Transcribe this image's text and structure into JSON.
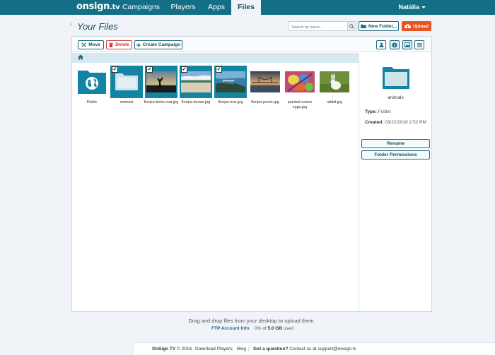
{
  "nav": {
    "logo": "onsign",
    "logo_tv": "tv",
    "items": [
      {
        "label": "Campaigns"
      },
      {
        "label": "Players"
      },
      {
        "label": "Apps"
      },
      {
        "label": "Files"
      }
    ],
    "active": "Files",
    "user": "Natália"
  },
  "header": {
    "title": "Your Files",
    "search_placeholder": "Search by name...",
    "new_folder_label": "New Folder...",
    "upload_label": "Upload"
  },
  "toolbar": {
    "move_label": "Move",
    "delete_label": "Delete",
    "create_campaign_label": "Create Campaign"
  },
  "files": [
    {
      "name": "Public",
      "kind": "folder-globe",
      "selected": false
    },
    {
      "name": "animals",
      "kind": "folder",
      "selected": true
    },
    {
      "name": "floripa-beira mar.jpg",
      "kind": "image",
      "selected": true
    },
    {
      "name": "floripa-dunas.jpg",
      "kind": "image",
      "selected": true
    },
    {
      "name": "floripa-mar.jpg",
      "kind": "image",
      "selected": true
    },
    {
      "name": "floripa-ponte.jpg",
      "kind": "image",
      "selected": false
    },
    {
      "name": "painted easter eggs.jpg",
      "kind": "image",
      "selected": false
    },
    {
      "name": "rabbit.jpg",
      "kind": "image",
      "selected": false
    }
  ],
  "details": {
    "name": "animals",
    "type_label": "Type:",
    "type_value": "Folder",
    "created_label": "Created:",
    "created_value": "03/22/2016 2:52 PM",
    "rename_label": "Rename",
    "permissions_label": "Folder Permissions"
  },
  "bottom": {
    "drop_text": "Drag and drop files from your desktop to upload them.",
    "ftp_label": "FTP Account Info",
    "usage_prefix": "0% of",
    "usage_total": "5.0 GB",
    "usage_suffix": "used"
  },
  "footer": {
    "brand": "OnSign TV",
    "copyright": "© 2016",
    "download_players": "Download Players",
    "blog": "Blog",
    "question": "Got a question?",
    "contact": "Contact us at support@onsign.tv"
  },
  "colors": {
    "nav": "#136f86",
    "accent": "#1484a3",
    "upload": "#e9541f",
    "delete": "#c03a3a"
  }
}
